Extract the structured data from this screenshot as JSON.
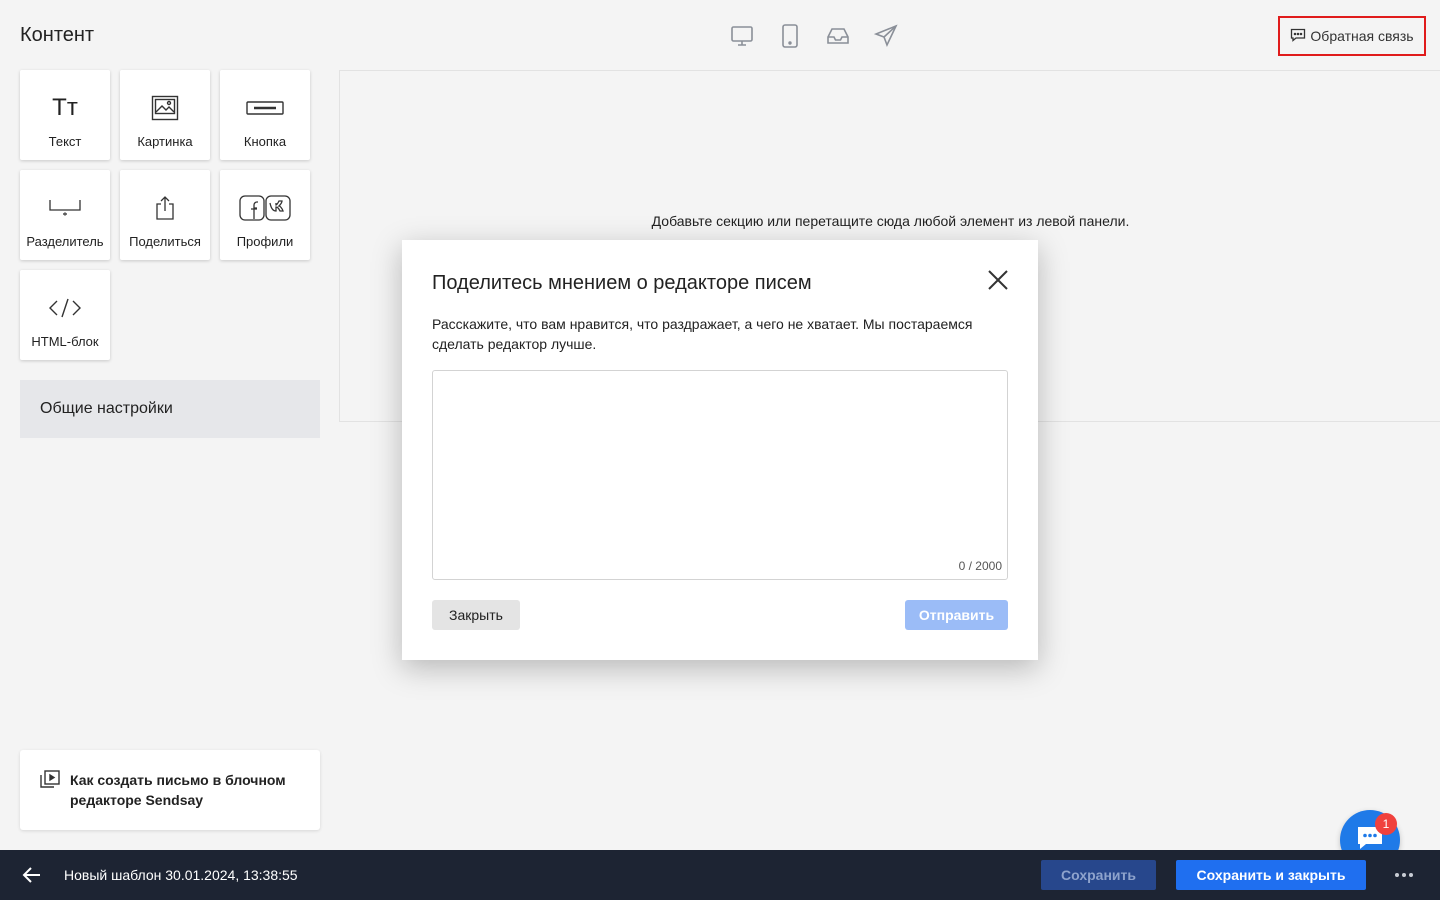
{
  "header": {
    "title": "Контент",
    "device_icons": [
      "desktop-icon",
      "mobile-icon",
      "inbox-icon",
      "send-icon"
    ],
    "feedback_label": "Обратная связь"
  },
  "sidebar": {
    "blocks": [
      {
        "label": "Текст",
        "icon": "text-icon",
        "glyph": "Тт"
      },
      {
        "label": "Картинка",
        "icon": "image-icon"
      },
      {
        "label": "Кнопка",
        "icon": "button-icon"
      },
      {
        "label": "Разделитель",
        "icon": "divider-icon"
      },
      {
        "label": "Поделиться",
        "icon": "share-icon"
      },
      {
        "label": "Профили",
        "icon": "social-profiles-icon"
      },
      {
        "label": "HTML-блок",
        "icon": "code-icon"
      }
    ],
    "general_settings": "Общие настройки",
    "howto_text": "Как создать письмо в блочном редакторе Sendsay"
  },
  "canvas": {
    "hint": "Добавьте секцию или перетащите сюда любой элемент из левой панели."
  },
  "modal": {
    "title": "Поделитесь мнением о редакторе писем",
    "description": "Расскажите, что вам нравится, что раздражает, а чего не хватает. Мы постараемся сделать редактор лучше.",
    "textarea_value": "",
    "counter": "0 / 2000",
    "close_label": "Закрыть",
    "send_label": "Отправить"
  },
  "chat": {
    "badge": "1"
  },
  "bottom_bar": {
    "template_name": "Новый шаблон 30.01.2024, 13:38:55",
    "save_label": "Сохранить",
    "save_close_label": "Сохранить и закрыть"
  },
  "colors": {
    "accent": "#1f6ff0",
    "bottom_bar_bg": "#1d2433",
    "highlight_border": "#e01b1b",
    "badge": "#f0413d"
  }
}
